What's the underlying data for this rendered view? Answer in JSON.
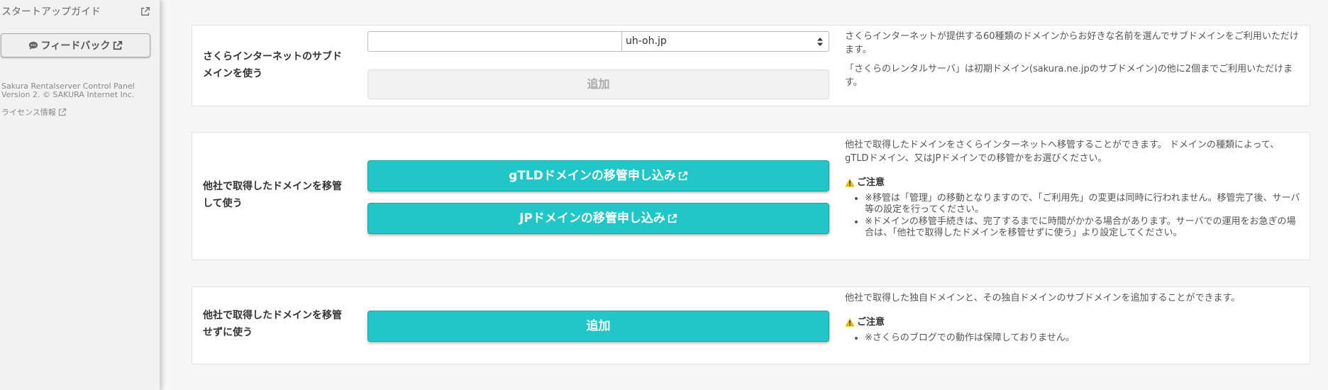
{
  "sidebar": {
    "startup_guide": "スタートアップガイド",
    "feedback": "フィードバック",
    "version_line1": "Sakura Rentalserver Control Panel",
    "version_line2": "Version 2. © SAKURA Internet Inc.",
    "license": "ライセンス情報"
  },
  "panel1": {
    "label": "さくらインターネットのサブドメインを使う",
    "input_value": "",
    "select_value": "uh-oh.jp",
    "add_button": "追加",
    "desc1": "さくらインターネットが提供する60種類のドメインからお好きな名前を選んでサブドメインをご利用いただけます。",
    "desc2": "「さくらのレンタルサーバ」は初期ドメイン(sakura.ne.jpのサブドメイン)の他に2個までご利用いただけます。"
  },
  "panel2": {
    "label": "他社で取得したドメインを移管して使う",
    "gtld_button": "gTLDドメインの移管申し込み",
    "jp_button": "JPドメインの移管申し込み",
    "desc": "他社で取得したドメインをさくらインターネットへ移管することができます。 ドメインの種類によって、gTLDドメイン、又はJPドメインでの移管かをお選びください。",
    "caution_title": "ご注意",
    "notes": [
      "※移管は「管理」の移動となりますので、「ご利用先」の変更は同時に行われません。移管完了後、サーバ等の設定を行ってください。",
      "※ドメインの移管手続きは、完了するまでに時間がかかる場合があります。サーバでの運用をお急ぎの場合は、「他社で取得したドメインを移管せずに使う」より設定してください。"
    ]
  },
  "panel3": {
    "label": "他社で取得したドメインを移管せずに使う",
    "add_button": "追加",
    "desc": "他社で取得した独自ドメインと、その独自ドメインのサブドメインを追加することができます。",
    "caution_title": "ご注意",
    "notes": [
      "※さくらのブログでの動作は保障しておりません。"
    ]
  },
  "colors": {
    "accent": "#21c6c6",
    "warning": "#e6b800"
  }
}
